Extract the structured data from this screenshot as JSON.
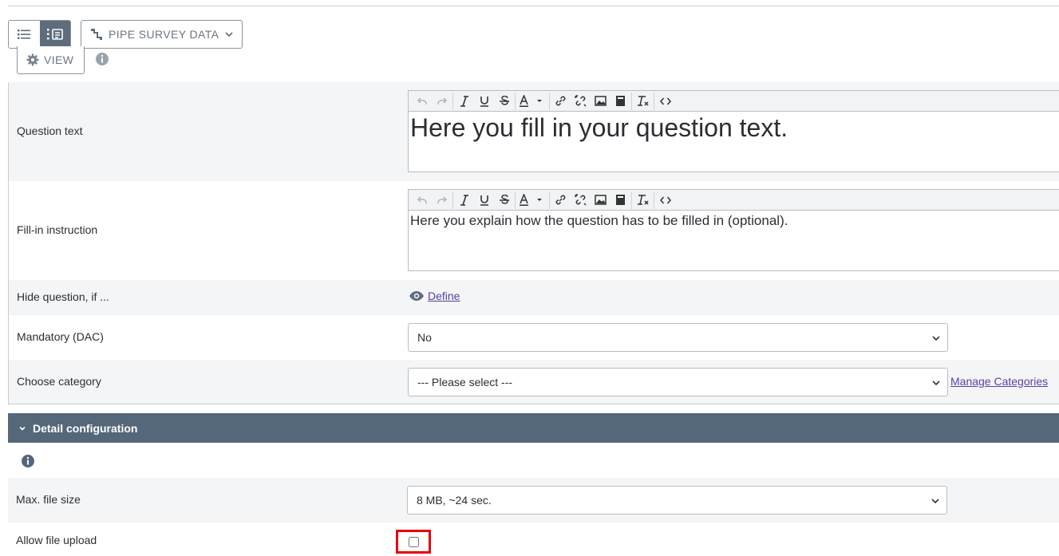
{
  "toolbar": {
    "survey_button_label": "PIPE SURVEY DATA",
    "view_button_label": "VIEW",
    "view_modes": [
      "list-view",
      "detail-view"
    ],
    "active_view": "detail-view"
  },
  "question": {
    "question_text_label": "Question text",
    "question_text_value": "Here you fill in your question text.",
    "fill_in_label": "Fill-in instruction",
    "fill_in_value": "Here you explain how the question has to be filled in (optional).",
    "hide_label": "Hide question, if ...",
    "hide_link": "Define",
    "mandatory_label": "Mandatory (DAC)",
    "mandatory_value": "No",
    "category_label": "Choose category",
    "category_value": "--- Please select ---",
    "manage_categories_link": "Manage Categories"
  },
  "detail": {
    "header": "Detail configuration",
    "max_file_size_label": "Max. file size",
    "max_file_size_value": "8 MB, ~24 sec.",
    "allow_upload_label": "Allow file upload",
    "allow_upload_checked": false
  },
  "editor_toolbar_icons": [
    "undo-icon",
    "redo-icon",
    "italic-icon",
    "underline-icon",
    "strikethrough-icon",
    "text-color-icon",
    "link-icon",
    "unlink-icon",
    "image-icon",
    "paste-icon",
    "clear-format-icon",
    "source-code-icon"
  ],
  "colors": {
    "accent": "#55687a",
    "link": "#5a3fa5",
    "highlight": "#e8000b",
    "row_shade": "#f4f5f6"
  }
}
